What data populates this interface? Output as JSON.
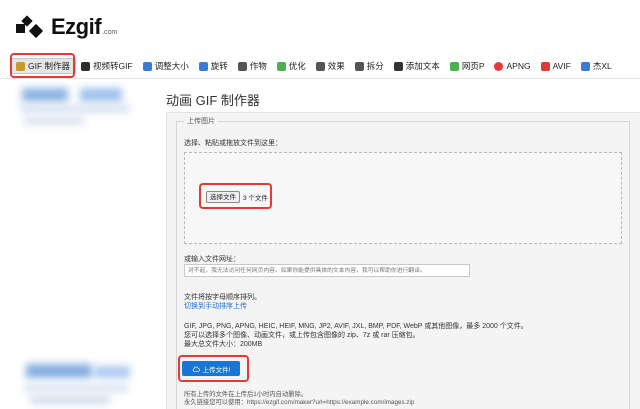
{
  "brand": {
    "name": "Ezgif",
    "suffix": ".com"
  },
  "nav": {
    "items": [
      {
        "label": "GIF 制作器",
        "icon": "gif-maker-icon",
        "color": "#c99a2e"
      },
      {
        "label": "视频转GIF",
        "icon": "video-to-gif-icon",
        "color": "#2d2d2d"
      },
      {
        "label": "调整大小",
        "icon": "resize-icon",
        "color": "#3a7bd5"
      },
      {
        "label": "旋转",
        "icon": "rotate-icon",
        "color": "#3a7bd5"
      },
      {
        "label": "作物",
        "icon": "crop-icon",
        "color": "#555555"
      },
      {
        "label": "优化",
        "icon": "optimize-icon",
        "color": "#4caf50"
      },
      {
        "label": "效果",
        "icon": "effects-icon",
        "color": "#555555"
      },
      {
        "label": "拆分",
        "icon": "split-icon",
        "color": "#555555"
      },
      {
        "label": "添加文本",
        "icon": "add-text-icon",
        "color": "#333333"
      },
      {
        "label": "网页P",
        "icon": "webp-icon",
        "color": "#4caf50"
      },
      {
        "label": "APNG",
        "icon": "apng-icon",
        "color": "#e53935"
      },
      {
        "label": "AVIF",
        "icon": "avif-icon",
        "color": "#e53935"
      },
      {
        "label": "杰XL",
        "icon": "jxl-icon",
        "color": "#3a7bd5"
      }
    ]
  },
  "main": {
    "title": "动画 GIF 制作器",
    "legend": "上传图片",
    "select_label": "选择、粘贴或拖放文件到这里：",
    "file_button": "选择文件",
    "file_count": "3 个文件",
    "url_label": "或输入文件网址：",
    "url_placeholder": "对不起，我无法访问任何网页内容。如果你能提供具体的文本内容，我可以帮助你进行翻译。",
    "sort_note": "文件将按字母顺序排列。",
    "manual_link": "切换到手动排序上传",
    "formats_note": "GIF, JPG, PNG, APNG, HEIC, HEIF, MNG, JP2, AVIF, JXL, BMP, PDF, WebP 或其他图像，最多 2000 个文件。",
    "archive_note": "您可以选择多个图像、动画文件，或上传包含图像的 zip、7z 或 rar 压缩包。",
    "max_size": "最大总文件大小：200MB",
    "upload_button": "上传文件!",
    "auto_delete_note": "所有上传的文件在上传后1小时内自动删除。",
    "permalink_note": "永久链接您可以使用：https://ezgif.com/maker?url=https://example.com/images.zip"
  },
  "colors": {
    "accent": "#1976d2",
    "highlight": "#e53935",
    "link": "#1a6fd1"
  }
}
